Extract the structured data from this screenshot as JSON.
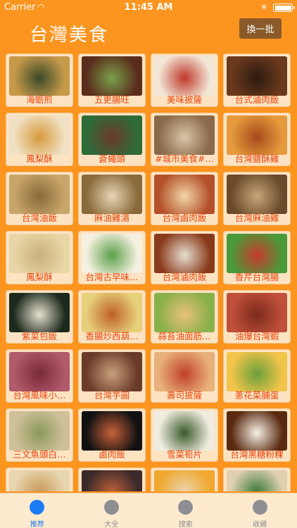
{
  "status": {
    "carrier": "Carrier",
    "time": "11:45 AM"
  },
  "nav": {
    "title": "台灣美食",
    "refresh_label": "換一批"
  },
  "grid": [
    {
      "label": "海蛎煎",
      "photo": "oyster-omelette-photo",
      "colors": [
        "#c79a4a",
        "#3b4a2a"
      ]
    },
    {
      "label": "五更腸旺",
      "photo": "intestine-stew-photo",
      "colors": [
        "#5a2c1c",
        "#7aa04a"
      ]
    },
    {
      "label": "美味披薩",
      "photo": "pizza-photo",
      "colors": [
        "#f2e6d6",
        "#c0392b"
      ]
    },
    {
      "label": "台式滷肉飯",
      "photo": "braised-pork-rice-photo",
      "colors": [
        "#6b3a1c",
        "#2c1a10"
      ]
    },
    {
      "label": "鳳梨酥",
      "photo": "pineapple-cake-photo",
      "colors": [
        "#f1e1c4",
        "#d69a3c"
      ]
    },
    {
      "label": "蒼蠅頭",
      "photo": "fly-head-stir-fry-photo",
      "colors": [
        "#2e6b39",
        "#6b3a2c"
      ]
    },
    {
      "label": "#城市美食#…",
      "photo": "city-food-soup-photo",
      "colors": [
        "#8a6a4a",
        "#d8c6a6"
      ]
    },
    {
      "label": "台灣鹽酥雞",
      "photo": "popcorn-chicken-photo",
      "colors": [
        "#e69a3c",
        "#a64a1c"
      ]
    },
    {
      "label": "台灣油飯",
      "photo": "oil-rice-photo",
      "colors": [
        "#c8a66a",
        "#8a6a3a"
      ]
    },
    {
      "label": "麻油雞湯",
      "photo": "sesame-chicken-soup-photo",
      "colors": [
        "#8a6a3a",
        "#e8d6b6"
      ]
    },
    {
      "label": "台灣鹵肉飯",
      "photo": "pork-rice-bowl-photo",
      "colors": [
        "#b4502a",
        "#f2d6a6"
      ]
    },
    {
      "label": "台灣麻油雞",
      "photo": "sesame-chicken-photo",
      "colors": [
        "#6a4a2a",
        "#c8a67a"
      ]
    },
    {
      "label": "鳳梨酥",
      "photo": "pineapple-cake-2-photo",
      "colors": [
        "#e8d6a6",
        "#c8b07a"
      ]
    },
    {
      "label": "台灣古早味…",
      "photo": "noodles-photo",
      "colors": [
        "#f6f0e0",
        "#5aa04a"
      ]
    },
    {
      "label": "台灣滷肉飯",
      "photo": "pork-rice-bowl-2-photo",
      "colors": [
        "#8a3a1c",
        "#e6e0d0"
      ]
    },
    {
      "label": "香芹台灣腸",
      "photo": "celery-sausage-photo",
      "colors": [
        "#4a9a3a",
        "#c83a2a"
      ]
    },
    {
      "label": "紫菜包飯",
      "photo": "seaweed-rice-roll-photo",
      "colors": [
        "#1c2a1c",
        "#e8e0d0"
      ]
    },
    {
      "label": "香腸炒西葫…",
      "photo": "sausage-zucchini-photo",
      "colors": [
        "#e6d07a",
        "#c0602a"
      ]
    },
    {
      "label": "蒜苔油面筋…",
      "photo": "garlic-shoot-gluten-photo",
      "colors": [
        "#8ab04a",
        "#e8c07a"
      ]
    },
    {
      "label": "油爆台灣蝦",
      "photo": "fried-shrimp-photo",
      "colors": [
        "#c0503a",
        "#7a2a1c"
      ]
    },
    {
      "label": "台灣風味小…",
      "photo": "sausages-photo",
      "colors": [
        "#b05a6a",
        "#7a2a3a"
      ]
    },
    {
      "label": "台灣芋圓",
      "photo": "taro-balls-photo",
      "colors": [
        "#6a3a2a",
        "#c8a07a"
      ]
    },
    {
      "label": "壽司披薩",
      "photo": "sushi-pizza-photo",
      "colors": [
        "#e8b07a",
        "#c0402a"
      ]
    },
    {
      "label": "蔥花菜脯蛋",
      "photo": "scallion-omelette-photo",
      "colors": [
        "#f2c44a",
        "#6aa03a"
      ]
    },
    {
      "label": "三文魚頭白…",
      "photo": "salmon-head-soup-photo",
      "colors": [
        "#d0c09a",
        "#8a9a5a"
      ]
    },
    {
      "label": "鹵肉飯",
      "photo": "braised-rice-photo",
      "colors": [
        "#111111",
        "#c8603a"
      ]
    },
    {
      "label": "雪菜筍片",
      "photo": "bamboo-shoot-photo",
      "colors": [
        "#f0ece0",
        "#3a5a2a"
      ]
    },
    {
      "label": "台灣黑糖粉粿",
      "photo": "brown-sugar-jelly-photo",
      "colors": [
        "#5a2a10",
        "#f6f0e6"
      ]
    },
    {
      "label": "",
      "photo": "partial-photo-1",
      "colors": [
        "#e8d6b0",
        "#c89a5a"
      ]
    },
    {
      "label": "",
      "photo": "partial-photo-2",
      "colors": [
        "#3a2a2a",
        "#c0603a"
      ]
    },
    {
      "label": "",
      "photo": "partial-photo-3",
      "colors": [
        "#f0a830",
        "#e8d6b0"
      ]
    },
    {
      "label": "",
      "photo": "partial-photo-4",
      "colors": [
        "#e0d0b0",
        "#3a7a3a"
      ]
    }
  ],
  "tabs": [
    {
      "label": "推荐",
      "active": true
    },
    {
      "label": "大全",
      "active": false
    },
    {
      "label": "搜索",
      "active": false
    },
    {
      "label": "收藏",
      "active": false
    }
  ]
}
